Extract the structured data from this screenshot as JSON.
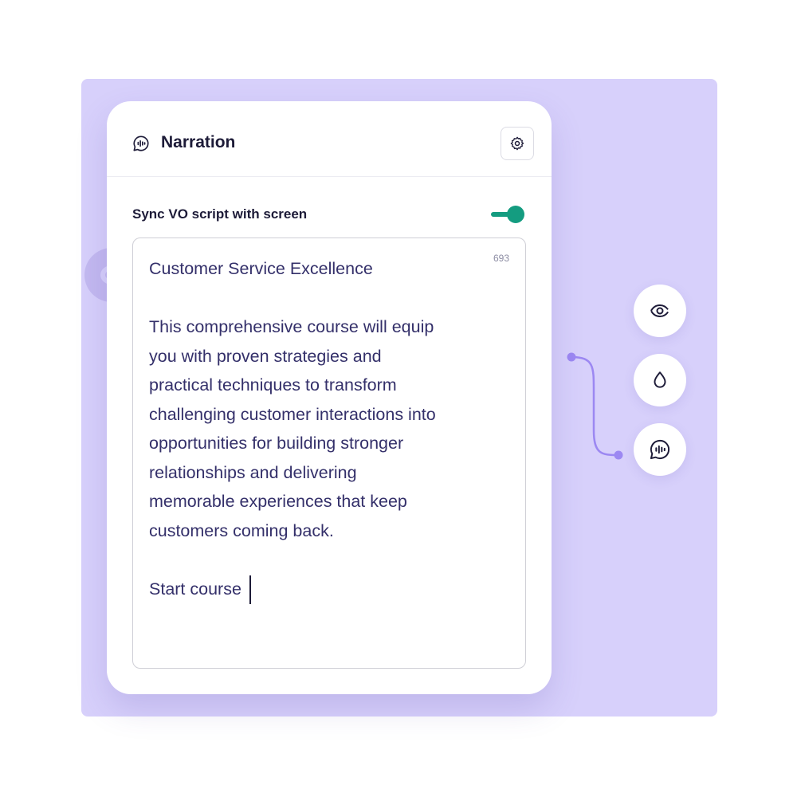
{
  "panel": {
    "title": "Narration",
    "title_icon": "narration-voice-icon",
    "settings_icon": "gear-icon",
    "sync_label": "Sync VO script with screen",
    "sync_enabled": true,
    "char_count": "693",
    "script_title": "Customer Service Excellence",
    "script_body_lines": [
      "This comprehensive course will equip",
      "you with proven strategies and",
      "practical techniques to transform",
      "challenging customer interactions into",
      "opportunities for building stronger",
      "relationships and delivering",
      "memorable experiences that keep",
      "customers coming back."
    ],
    "script_cta": "Start course"
  },
  "side_tools": [
    {
      "name": "visibility-button",
      "icon": "eye-icon"
    },
    {
      "name": "color-button",
      "icon": "drop-icon"
    },
    {
      "name": "narration-button",
      "icon": "narration-voice-icon"
    }
  ],
  "colors": {
    "canvas": "#d7d0fb",
    "accent": "#149c80",
    "connector": "#9c88f2",
    "text": "#34306a"
  }
}
